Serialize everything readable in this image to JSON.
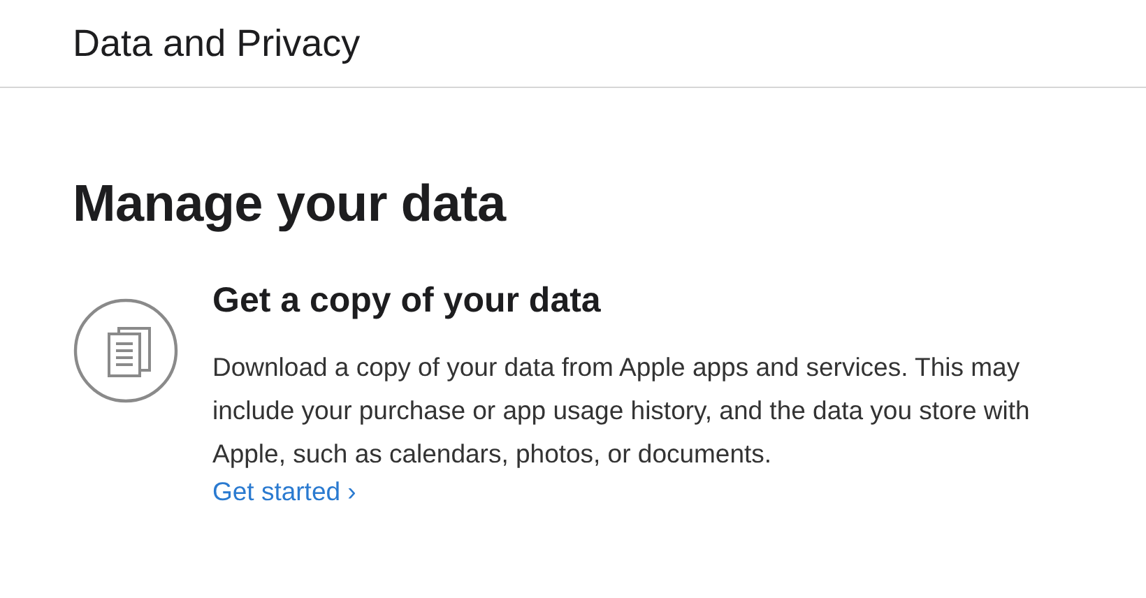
{
  "header": {
    "title": "Data and Privacy"
  },
  "section": {
    "title": "Manage your data",
    "items": [
      {
        "title": "Get a copy of your data",
        "description": "Download a copy of your data from Apple apps and services. This may include your purchase or app usage history, and the data you store with Apple, such as calendars, photos, or documents.",
        "link": "Get started ›"
      }
    ]
  }
}
